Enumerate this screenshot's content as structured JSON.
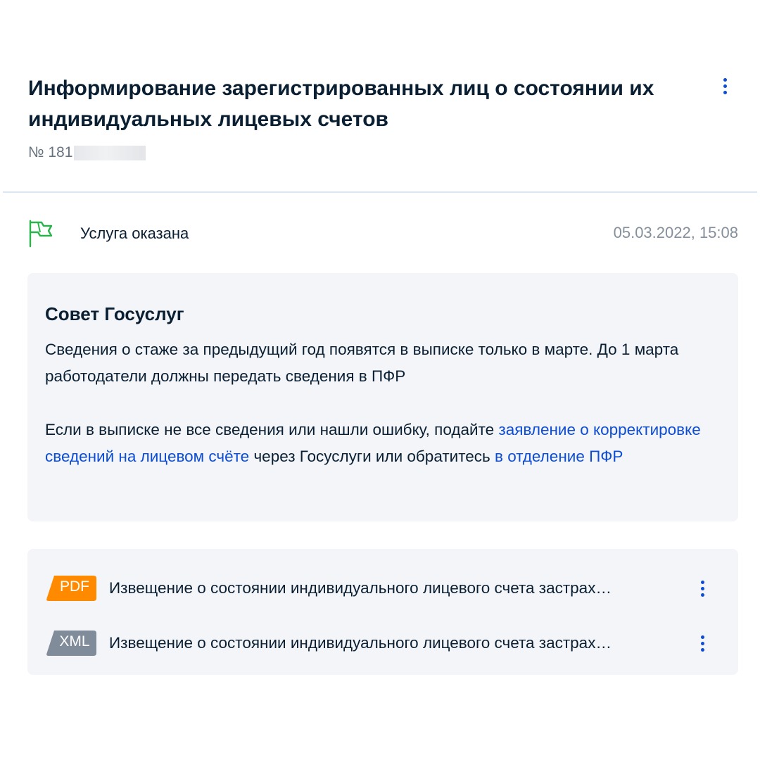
{
  "header": {
    "title": "Информирование зарегистрированных лиц о состоянии их индивидуальных лицевых счетов",
    "number_prefix": "№ 181",
    "menu_icon": "kebab-vertical-icon"
  },
  "status": {
    "icon": "flag-icon",
    "icon_color": "#2bb24c",
    "text": "Услуга оказана",
    "datetime": "05.03.2022, 15:08"
  },
  "tip": {
    "title": "Совет Госуслуг",
    "paragraph1": "Сведения о стаже за предыдущий год появятся в выписке только в марте. До 1 марта работодатели должны передать сведения в ПФР",
    "paragraph2_start": "Если в выписке не все сведения или нашли ошибку, подайте ",
    "paragraph2_link1": "заявление о корректировке сведений на лицевом счёте",
    "paragraph2_middle": " через Госуслуги или обратитесь ",
    "paragraph2_link2": "в отделение ПФР"
  },
  "files": [
    {
      "type": "PDF",
      "badge_color": "#ff8a00",
      "name": "Извещение о состоянии индивидуального лицевого счета застрах…"
    },
    {
      "type": "XML",
      "badge_color": "#808c9a",
      "name": "Извещение о состоянии индивидуального лицевого счета застрах…"
    }
  ],
  "colors": {
    "link": "#0d4cd3",
    "card_background": "#f3f5f9",
    "muted_text": "#86909c"
  }
}
